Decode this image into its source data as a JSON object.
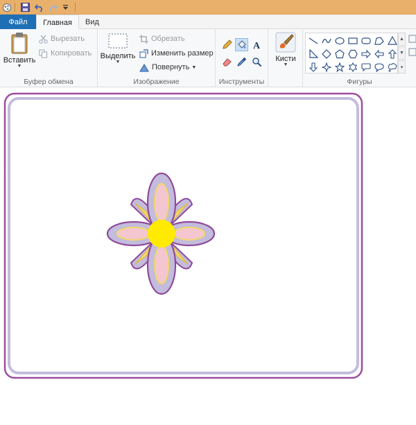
{
  "ribbon_tabs": {
    "file": "Файл",
    "home": "Главная",
    "view": "Вид"
  },
  "clipboard": {
    "paste": "Вставить",
    "cut": "Вырезать",
    "copy": "Копировать",
    "group_label": "Буфер обмена"
  },
  "image": {
    "select": "Выделить",
    "crop": "Обрезать",
    "resize": "Изменить размер",
    "rotate": "Повернуть",
    "group_label": "Изображение"
  },
  "tools": {
    "group_label": "Инструменты"
  },
  "brushes": {
    "label": "Кисти"
  },
  "shapes": {
    "group_label": "Фигуры"
  },
  "colors": {
    "title_bar": "#e8b06a",
    "file_tab": "#1e6fb5",
    "frame_outer": "#9b4fa0",
    "frame_inner": "#c3bcdc",
    "petal_fill": "#c3bcdc",
    "petal_stroke": "#8e4a9a",
    "petal_inner": "#f4c6cf",
    "petal_accent": "#f1d86a",
    "flower_center": "#ffea00"
  }
}
